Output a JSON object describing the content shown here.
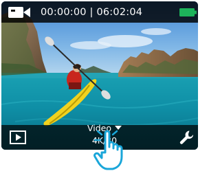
{
  "status_bar": {
    "mode_icon": "video-camera-icon",
    "recorded_time": "00:00:00",
    "separator": "|",
    "remaining_time": "06:02:04",
    "battery_icon": "battery-full-icon",
    "battery_color": "#1db35a"
  },
  "bottom_bar": {
    "playback_icon": "playback-icon",
    "mode_label": "Video",
    "dropdown_icon": "caret-down-icon",
    "resolution": "4K/30",
    "settings_icon": "wrench-icon"
  },
  "viewfinder": {
    "content_icon": "kayaker-photo"
  },
  "overlay": {
    "gesture_icon": "tap-hand-icon"
  }
}
